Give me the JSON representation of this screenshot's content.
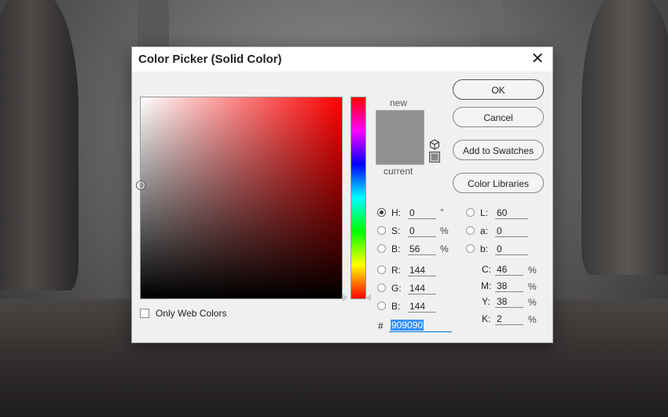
{
  "dialog": {
    "title": "Color Picker (Solid Color)",
    "new_label": "new",
    "current_label": "current",
    "new_color": "#909090",
    "current_color": "#909090",
    "buttons": {
      "ok": "OK",
      "cancel": "Cancel",
      "add_to_swatches": "Add to Swatches",
      "color_libraries": "Color Libraries"
    },
    "hsb": [
      {
        "label": "H:",
        "value": "0",
        "unit": "°",
        "selected": true
      },
      {
        "label": "S:",
        "value": "0",
        "unit": "%",
        "selected": false
      },
      {
        "label": "B:",
        "value": "56",
        "unit": "%",
        "selected": false
      }
    ],
    "rgb": [
      {
        "label": "R:",
        "value": "144"
      },
      {
        "label": "G:",
        "value": "144"
      },
      {
        "label": "B:",
        "value": "144"
      }
    ],
    "lab": [
      {
        "label": "L:",
        "value": "60"
      },
      {
        "label": "a:",
        "value": "0"
      },
      {
        "label": "b:",
        "value": "0"
      }
    ],
    "cmyk": [
      {
        "label": "C:",
        "value": "46",
        "unit": "%"
      },
      {
        "label": "M:",
        "value": "38",
        "unit": "%"
      },
      {
        "label": "Y:",
        "value": "38",
        "unit": "%"
      },
      {
        "label": "K:",
        "value": "2",
        "unit": "%"
      }
    ],
    "hex_prefix": "#",
    "hex_value": "909090",
    "only_web_colors_label": "Only Web Colors",
    "only_web_colors_checked": false,
    "field_hue_color": "#ff0000",
    "icons": {
      "close": "close-icon",
      "gamut": "cube-icon",
      "websafe": "websafe-cube-icon"
    }
  }
}
